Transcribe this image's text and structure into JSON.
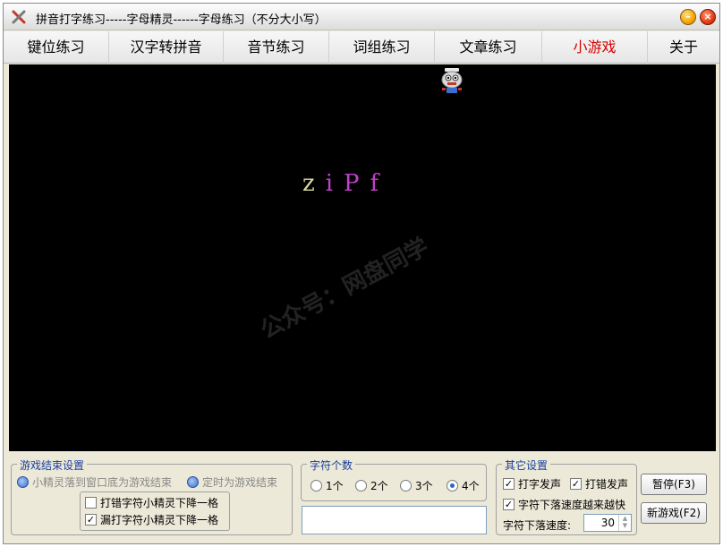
{
  "window": {
    "title": "拼音打字练习-----字母精灵------字母练习（不分大小写）"
  },
  "tabs": [
    {
      "label": "键位练习"
    },
    {
      "label": "汉字转拼音"
    },
    {
      "label": "音节练习"
    },
    {
      "label": "词组练习"
    },
    {
      "label": "文章练习"
    },
    {
      "label": "小游戏"
    },
    {
      "label": "关于"
    }
  ],
  "game": {
    "letters": [
      {
        "char": "z",
        "color": "#d8d8a0"
      },
      {
        "char": "i",
        "color": "#c040c8"
      },
      {
        "char": "P",
        "color": "#c040c8"
      },
      {
        "char": "f",
        "color": "#c040c8"
      }
    ],
    "sprite_icon": "robot-sprite-icon"
  },
  "watermark": "公众号：网盘同学",
  "end_settings": {
    "title": "游戏结束设置",
    "radio_bottom": "小精灵落到窗口底为游戏结束",
    "radio_timed": "定时为游戏结束",
    "check_miss": "打错字符小精灵下降一格",
    "check_skip": "漏打字符小精灵下降一格"
  },
  "char_count": {
    "title": "字符个数",
    "options": [
      "1个",
      "2个",
      "3个",
      "4个"
    ]
  },
  "other_settings": {
    "title": "其它设置",
    "check_type_sound": "打字发声",
    "check_error_sound": "打错发声",
    "check_speedup": "字符下落速度越来越快",
    "speed_label": "字符下落速度:",
    "speed_value": "30"
  },
  "buttons": {
    "pause": "暂停(F3)",
    "new_game": "新游戏(F2)"
  },
  "colors": {
    "active_tab": "#d40000",
    "group_title": "#1a3f9b"
  }
}
